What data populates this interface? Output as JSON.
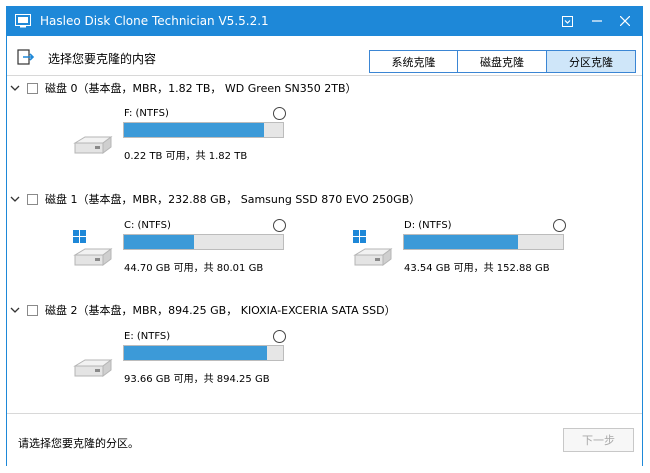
{
  "window": {
    "title": "Hasleo Disk Clone Technician V5.5.2.1",
    "accent_color": "#1e88d8",
    "controls": [
      "menu-icon",
      "minimize-icon",
      "close-icon"
    ]
  },
  "toolbar": {
    "title": "选择您要克隆的内容",
    "tabs": [
      {
        "label": "系统克隆",
        "selected": false
      },
      {
        "label": "磁盘克隆",
        "selected": false
      },
      {
        "label": "分区克隆",
        "selected": true
      }
    ]
  },
  "disks": [
    {
      "header": "磁盘 0（基本盘，MBR，1.82 TB， WD Green SN350 2TB）",
      "partitions": [
        {
          "label": "F: (NTFS)",
          "capacity_text": "0.22 TB 可用，共 1.82 TB",
          "used_fraction": 0.88,
          "is_system": false,
          "icon": "drive-icon"
        }
      ]
    },
    {
      "header": "磁盘 1（基本盘，MBR，232.88 GB， Samsung SSD 870 EVO 250GB）",
      "partitions": [
        {
          "label": "C: (NTFS)",
          "capacity_text": "44.70 GB 可用，共 80.01 GB",
          "used_fraction": 0.44,
          "is_system": true,
          "icon": "windows-drive-icon"
        },
        {
          "label": "D: (NTFS)",
          "capacity_text": "43.54 GB 可用，共 152.88 GB",
          "used_fraction": 0.72,
          "is_system": true,
          "icon": "windows-drive-icon"
        }
      ]
    },
    {
      "header": "磁盘 2（基本盘，MBR，894.25 GB， KIOXIA-EXCERIA SATA SSD）",
      "partitions": [
        {
          "label": "E: (NTFS)",
          "capacity_text": "93.66 GB 可用，共 894.25 GB",
          "used_fraction": 0.9,
          "is_system": false,
          "icon": "drive-icon"
        }
      ]
    }
  ],
  "footer": {
    "status": "请选择您要克隆的分区。",
    "next_label": "下一步",
    "next_enabled": false
  }
}
